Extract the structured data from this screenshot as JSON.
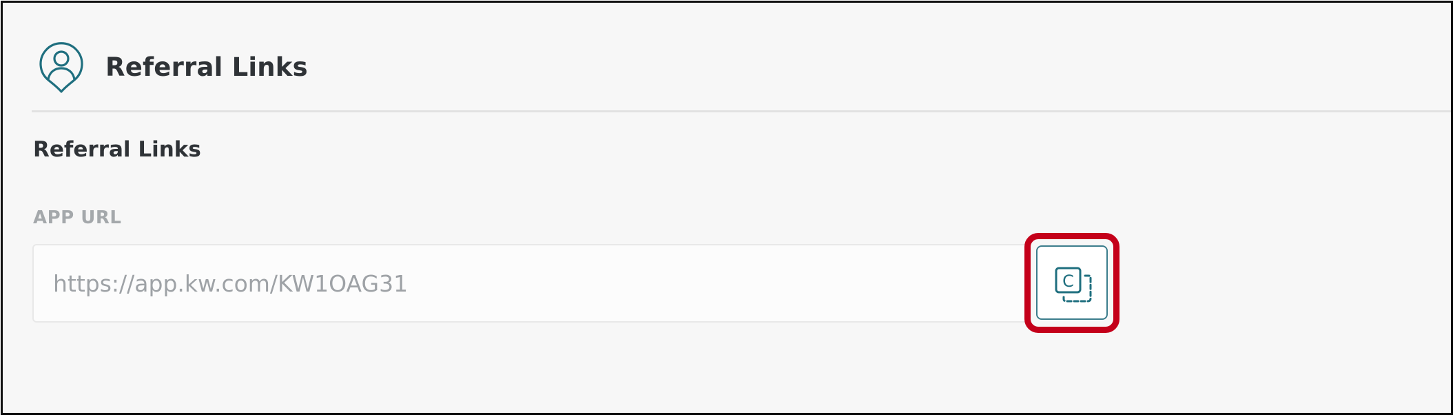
{
  "header": {
    "title": "Referral Links",
    "icon": "user-location-pin-icon"
  },
  "section": {
    "title": "Referral Links"
  },
  "app_url": {
    "label": "APP URL",
    "value": "https://app.kw.com/KW1OAG31",
    "copy_button_icon": "copy-icon",
    "copy_button_glyph": "C"
  },
  "colors": {
    "accent": "#1f6f7f",
    "highlight": "#c4001a",
    "title_text": "#2f3337",
    "muted_text": "#a4a8ab"
  }
}
